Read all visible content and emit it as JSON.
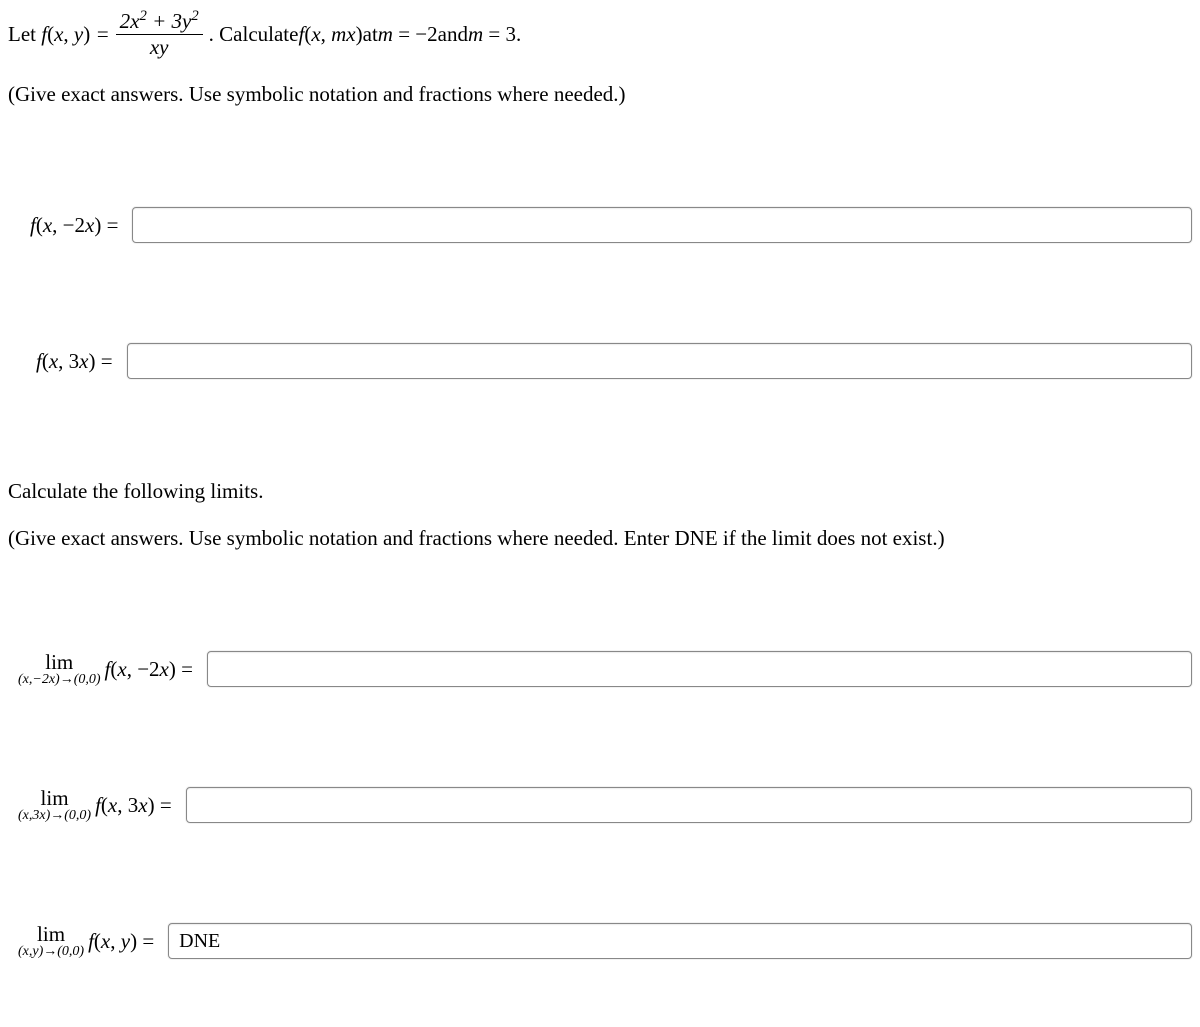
{
  "problem": {
    "let_prefix": "Let ",
    "func_def": "f(x, y) = ",
    "numerator": "2x² + 3y²",
    "denominator": "xy",
    "calc_text": ". Calculate ",
    "calc_func": "f(x, mx)",
    "calc_suffix": " at ",
    "m_neg2": "m = −2",
    "and": " and ",
    "m_3": "m = 3."
  },
  "instruction1": "(Give exact answers. Use symbolic notation and fractions where needed.)",
  "answers": {
    "q1_label": "f(x, −2x) =",
    "q1_value": "",
    "q2_label": "f(x, 3x) =",
    "q2_value": ""
  },
  "section2_text": "Calculate the following limits.",
  "instruction2": "(Give exact answers. Use symbolic notation and fractions where needed. Enter DNE if the limit does not exist.)",
  "limits": {
    "q3": {
      "lim": "lim",
      "sub": "(x,−2x)→(0,0)",
      "func": "f(x, −2x) =",
      "value": ""
    },
    "q4": {
      "lim": "lim",
      "sub": "(x,3x)→(0,0)",
      "func": "f(x, 3x) =",
      "value": ""
    },
    "q5": {
      "lim": "lim",
      "sub": "(x,y)→(0,0)",
      "func": "f(x, y) =",
      "value": "DNE"
    }
  }
}
